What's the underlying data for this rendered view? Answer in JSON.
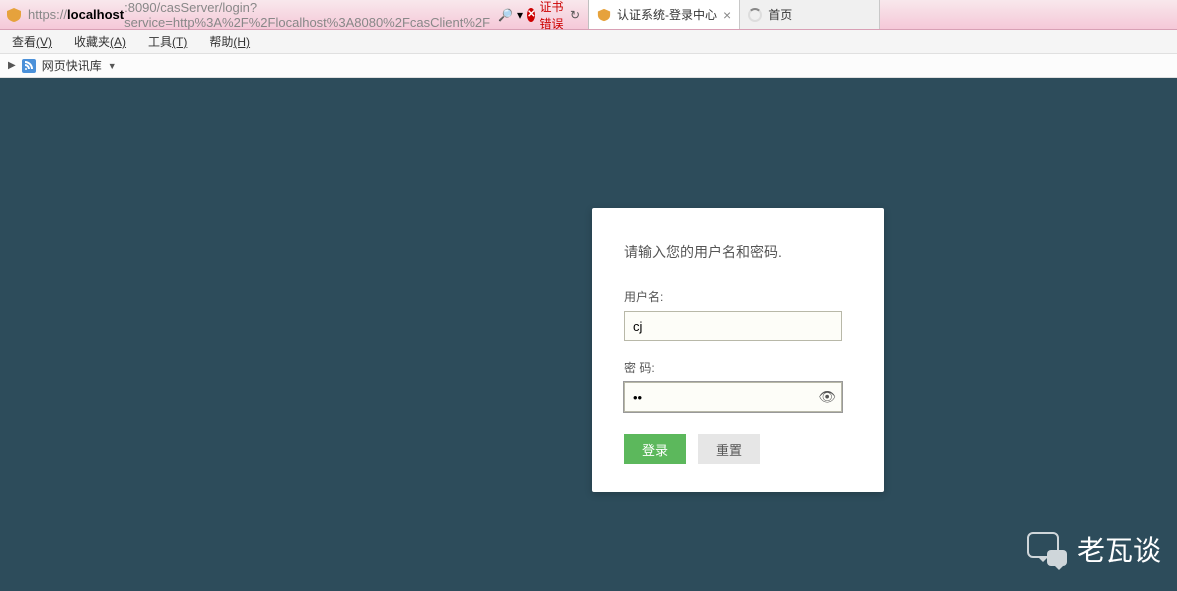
{
  "addressBar": {
    "urlPrefix": "https://",
    "urlHost": "localhost",
    "urlRest": ":8090/casServer/login?service=http%3A%2F%2Flocalhost%3A8080%2FcasClient%2F",
    "certError": "证书错误"
  },
  "tabs": [
    {
      "title": "认证系统-登录中心"
    },
    {
      "title": "首页"
    }
  ],
  "menuBar": {
    "view": "查看",
    "viewKey": "(V)",
    "favorites": "收藏夹",
    "favoritesKey": "(A)",
    "tools": "工具",
    "toolsKey": "(T)",
    "help": "帮助",
    "helpKey": "(H)"
  },
  "favBar": {
    "label": "网页快讯库"
  },
  "loginCard": {
    "heading": "请输入您的用户名和密码.",
    "usernameLabel": "用户名:",
    "usernameValue": "cj",
    "passwordLabel": "密   码:",
    "passwordValue": "••",
    "loginBtn": "登录",
    "resetBtn": "重置"
  },
  "watermark": {
    "text": "老瓦谈"
  }
}
